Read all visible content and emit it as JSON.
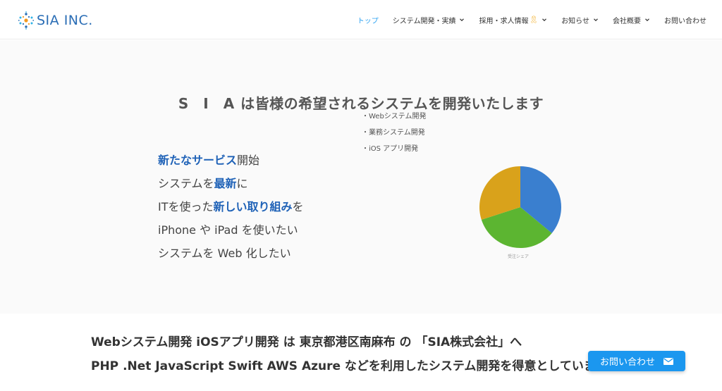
{
  "header": {
    "logo_text": "SIA INC.",
    "nav": [
      {
        "label": "トップ",
        "active": true,
        "has_dropdown": false
      },
      {
        "label": "システム開発・実績",
        "active": false,
        "has_dropdown": true
      },
      {
        "label": "採用・求人情報",
        "active": false,
        "has_dropdown": true
      },
      {
        "label": "お知らせ",
        "active": false,
        "has_dropdown": true
      },
      {
        "label": "会社概要",
        "active": false,
        "has_dropdown": true
      },
      {
        "label": "お問い合わせ",
        "active": false,
        "has_dropdown": false
      }
    ]
  },
  "hero": {
    "tagline_sia": "S I A",
    "tagline_rest": "は皆様の希望されるシステムを開発いたします",
    "features": [
      [
        {
          "t": "新たなサービス",
          "h": true
        },
        {
          "t": "開始",
          "h": false
        }
      ],
      [
        {
          "t": "システムを",
          "h": false
        },
        {
          "t": "最新",
          "h": true
        },
        {
          "t": "に",
          "h": false
        }
      ],
      [
        {
          "t": "ITを使った",
          "h": false
        },
        {
          "t": "新しい取り組み",
          "h": true
        },
        {
          "t": "を",
          "h": false
        }
      ],
      [
        {
          "t": "iPhone や iPad を使いたい",
          "h": false
        }
      ],
      [
        {
          "t": "システムを Web 化したい",
          "h": false
        }
      ]
    ]
  },
  "chart_data": {
    "type": "pie",
    "title": "受注シェア",
    "slices": [
      {
        "label": "Webシステム開発",
        "value": 36,
        "color": "#3a7fcf"
      },
      {
        "label": "業務システム開発",
        "value": 34,
        "color": "#5cb531"
      },
      {
        "label": "iOS アプリ開発",
        "value": 30,
        "color": "#d9a21b"
      }
    ]
  },
  "bottom": {
    "line1": "Webシステム開発  iOSアプリ開発 は 東京都港区南麻布 の 「SIA株式会社」へ",
    "line2": "PHP .Net JavaScript Swift AWS Azure などを利用したシステム開発を得意としています"
  },
  "contact_button": {
    "label": "お問い合わせ"
  },
  "colors": {
    "accent": "#2ea3f2",
    "highlight": "#1f62b7",
    "button": "#1b97ef"
  }
}
